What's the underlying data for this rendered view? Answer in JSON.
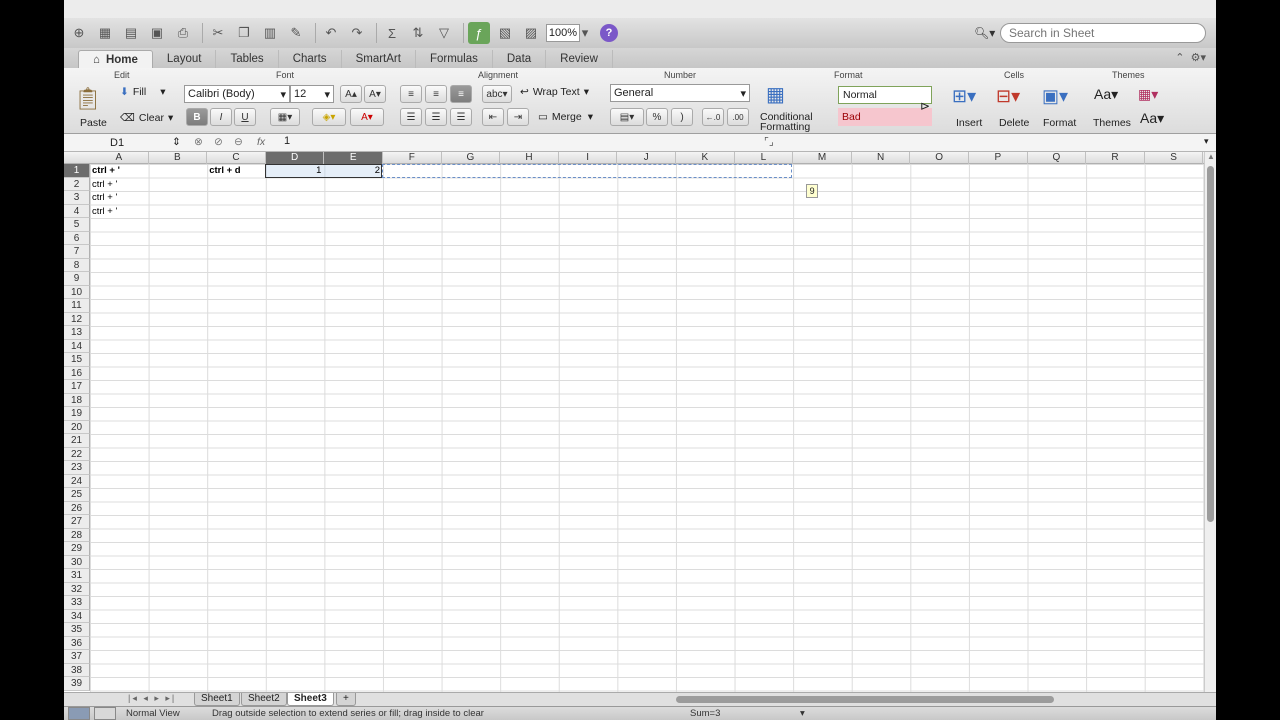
{
  "toolbar": {
    "zoom": "100%",
    "help_label": "?",
    "search_placeholder": "Search in Sheet"
  },
  "ribbon_tabs": [
    "Home",
    "Layout",
    "Tables",
    "Charts",
    "SmartArt",
    "Formulas",
    "Data",
    "Review"
  ],
  "ribbon": {
    "groups": {
      "edit": "Edit",
      "font": "Font",
      "alignment": "Alignment",
      "number": "Number",
      "format": "Format",
      "cells": "Cells",
      "themes": "Themes"
    },
    "paste": "Paste",
    "fill": "Fill",
    "clear": "Clear",
    "font_name": "Calibri (Body)",
    "font_size": "12",
    "bold": "B",
    "italic": "I",
    "underline": "U",
    "grow": "A",
    "shrink": "A",
    "wrap_text": "Wrap Text",
    "merge": "Merge",
    "number_format": "General",
    "percent": "%",
    "comma": ")",
    "conditional_formatting_1": "Conditional",
    "conditional_formatting_2": "Formatting",
    "style_normal": "Normal",
    "style_bad": "Bad",
    "insert": "Insert",
    "delete": "Delete",
    "format": "Format",
    "themes": "Themes",
    "abc": "abc"
  },
  "formula_bar": {
    "name_box": "D1",
    "fx": "fx",
    "content": "1"
  },
  "grid": {
    "columns": [
      "A",
      "B",
      "C",
      "D",
      "E",
      "F",
      "G",
      "H",
      "I",
      "J",
      "K",
      "L",
      "M",
      "N",
      "O",
      "P",
      "Q",
      "R",
      "S"
    ],
    "rows": [
      "1",
      "2",
      "3",
      "4",
      "5",
      "6",
      "7",
      "8",
      "9",
      "10",
      "11",
      "12",
      "13",
      "14",
      "15",
      "16",
      "17",
      "18",
      "19",
      "20",
      "21",
      "22",
      "23",
      "24",
      "25",
      "26",
      "27",
      "28",
      "29",
      "30",
      "31",
      "32",
      "33",
      "34",
      "35",
      "36",
      "37",
      "38",
      "39"
    ],
    "cells": {
      "A1": "ctrl + '",
      "A2": "ctrl + '",
      "A3": "ctrl + '",
      "A4": "ctrl + '",
      "C1": "ctrl + d",
      "D1": "1",
      "E1": "2"
    },
    "fill_tip": "9"
  },
  "sheets": [
    "Sheet1",
    "Sheet2",
    "Sheet3"
  ],
  "add_sheet": "+",
  "status": {
    "view": "Normal View",
    "message": "Drag outside selection to extend series or fill; drag inside to clear",
    "sum": "Sum=3"
  }
}
